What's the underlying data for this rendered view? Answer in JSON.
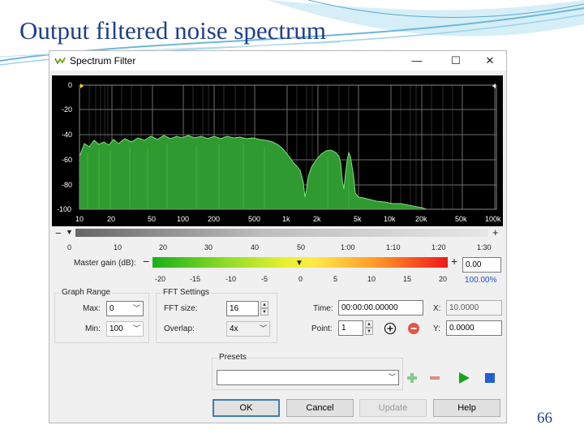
{
  "slide": {
    "title": "Output filtered noise spectrum",
    "page_number": "66"
  },
  "window": {
    "title": "Spectrum Filter",
    "minimize": "—",
    "maximize": "☐",
    "close": "✕"
  },
  "graph": {
    "y_ticks": [
      "0",
      "-20",
      "-40",
      "-60",
      "-80",
      "-100"
    ],
    "x_ticks": [
      "10",
      "20",
      "50",
      "100",
      "200",
      "500",
      "1k",
      "2k",
      "5k",
      "10k",
      "20k",
      "50k",
      "100k"
    ]
  },
  "time_scale": {
    "minus": "−",
    "plus": "+",
    "ticks": [
      "0",
      "10",
      "20",
      "30",
      "40",
      "50",
      "1:00",
      "1:10",
      "1:20",
      "1:30"
    ]
  },
  "master_gain": {
    "label": "Master gain (dB):",
    "minus": "−",
    "plus": "+",
    "ticks": [
      "-20",
      "-15",
      "-10",
      "-5",
      "0",
      "5",
      "10",
      "15",
      "20"
    ],
    "value": "0.00",
    "percent": "100.00%"
  },
  "graph_range": {
    "title": "Graph Range",
    "max_label": "Max:",
    "max_value": "0",
    "min_label": "Min:",
    "min_value": "100"
  },
  "fft_settings": {
    "title": "FFT Settings",
    "size_label": "FFT size:",
    "size_value": "16",
    "overlap_label": "Overlap:",
    "overlap_value": "4x"
  },
  "time_point": {
    "time_label": "Time:",
    "time_value": "00:00:00.00000",
    "point_label": "Point:",
    "point_value": "1",
    "x_label": "X:",
    "x_value": "10.0000",
    "y_label": "Y:",
    "y_value": "0.0000"
  },
  "presets": {
    "title": "Presets",
    "value": ""
  },
  "buttons": {
    "ok": "OK",
    "cancel": "Cancel",
    "update": "Update",
    "help": "Help"
  },
  "colors": {
    "spectrum_fill": "#2f9a2f",
    "spectrum_edge": "#7fe07f",
    "grid": "#7a7a7a",
    "selection": "#3c7fb1"
  }
}
